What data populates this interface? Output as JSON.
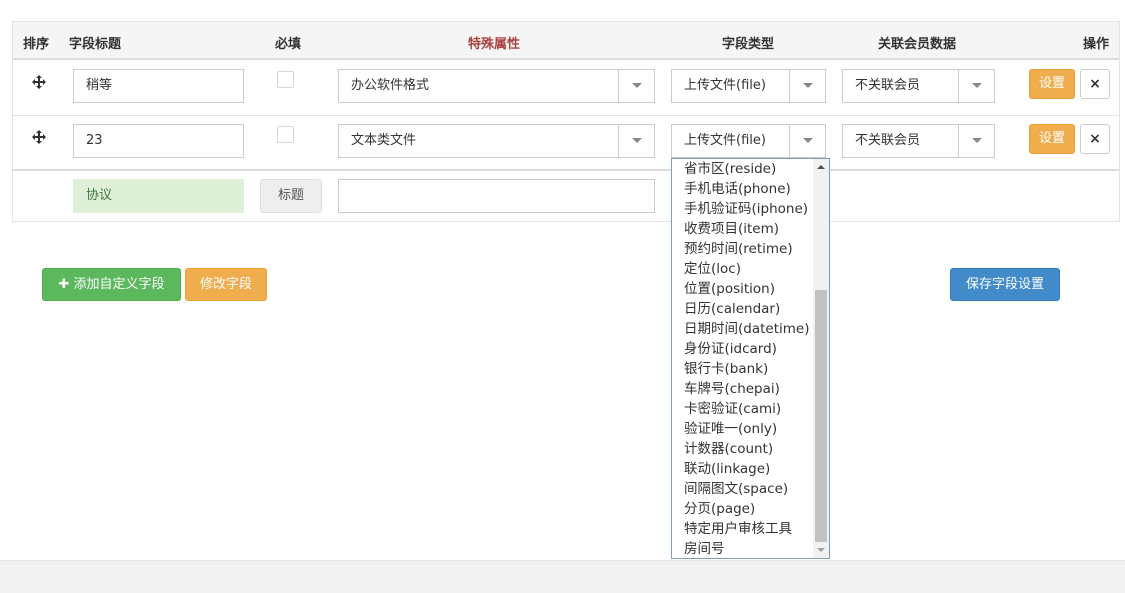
{
  "headers": {
    "sort": "排序",
    "title": "字段标题",
    "required": "必填",
    "special": "特殊属性",
    "type": "字段类型",
    "member": "关联会员数据",
    "ops": "操作"
  },
  "rows": [
    {
      "title": "稍等",
      "special": "办公软件格式",
      "type": "上传文件(file)",
      "member": "不关联会员",
      "settings": "设置",
      "delete": "×"
    },
    {
      "title": "23",
      "special": "文本类文件",
      "type": "上传文件(file)",
      "member": "不关联会员",
      "settings": "设置",
      "delete": "×"
    }
  ],
  "new_row": {
    "title_value": "协议",
    "title_button": "标题",
    "extra_value": ""
  },
  "buttons": {
    "add_custom": "添加自定义字段",
    "modify": "修改字段",
    "save": "保存字段设置"
  },
  "dropdown_options": [
    "省市区(reside)",
    "手机电话(phone)",
    "手机验证码(iphone)",
    "收费项目(item)",
    "预约时间(retime)",
    "定位(loc)",
    "位置(position)",
    "日历(calendar)",
    "日期时间(datetime)",
    "身份证(idcard)",
    "银行卡(bank)",
    "车牌号(chepai)",
    "卡密验证(cami)",
    "验证唯一(only)",
    "计数器(count)",
    "联动(linkage)",
    "间隔图文(space)",
    "分页(page)",
    "特定用户审核工具",
    "房间号"
  ],
  "colors": {
    "warning": "#f0ad4e",
    "success": "#5cb85c",
    "primary": "#428bca",
    "special_header": "#a94442",
    "green_input": "#dff0d8"
  },
  "icons": {
    "move": "move-arrows-icon",
    "plus": "plus-icon",
    "close": "close-icon",
    "select_arrow": "caret-down-icon"
  }
}
